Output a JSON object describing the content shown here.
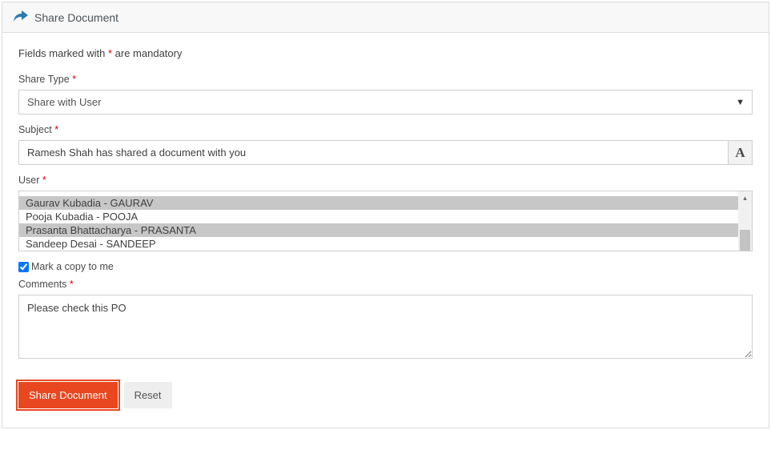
{
  "header": {
    "title": "Share Document",
    "icon": "share-forward-icon"
  },
  "mandatory_note_prefix": "Fields marked with ",
  "mandatory_note_star": "*",
  "mandatory_note_suffix": " are mandatory",
  "fields": {
    "share_type": {
      "label": "Share Type",
      "required_star": "*",
      "value": "Share with User"
    },
    "subject": {
      "label": "Subject",
      "required_star": "*",
      "value": "Ramesh Shah has shared a document with you",
      "font_button": "A"
    },
    "user": {
      "label": "User",
      "required_star": "*",
      "items": [
        {
          "text": "Gaurav Kubadia - GAURAV",
          "selected": true
        },
        {
          "text": "Pooja Kubadia - POOJA",
          "selected": false
        },
        {
          "text": "Prasanta Bhattacharya - PRASANTA",
          "selected": true
        },
        {
          "text": "Sandeep Desai - SANDEEP",
          "selected": false
        }
      ]
    },
    "mark_copy": {
      "label": "Mark a copy to me",
      "checked": true
    },
    "comments": {
      "label": "Comments",
      "required_star": "*",
      "value": "Please check this PO"
    }
  },
  "buttons": {
    "primary": "Share Document",
    "secondary": "Reset"
  }
}
